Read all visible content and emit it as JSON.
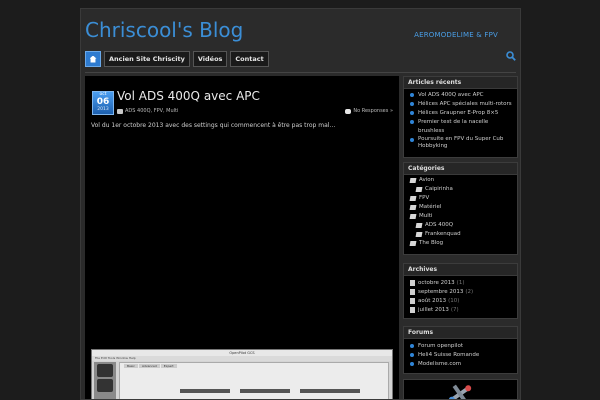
{
  "site": {
    "title": "Chriscool's Blog",
    "tagline": "AEROMODELIME & FPV"
  },
  "nav": {
    "items": [
      {
        "label": "Ancien Site Chriscity"
      },
      {
        "label": "Vidéos"
      },
      {
        "label": "Contact"
      }
    ]
  },
  "post": {
    "date": {
      "month": "oct",
      "day": "06",
      "year": "2013"
    },
    "title": "Vol ADS 400Q avec APC",
    "categories": "ADS 400Q, FPV, Multi",
    "comments": "No Responses »",
    "excerpt": "Vol du 1er octobre 2013 avec des settings qui commencent à être pas trop mal…",
    "screenshot": {
      "window_title": "OpenPilot GCS",
      "menu": "File   Edit   Tools   Window   Help",
      "tabs": [
        "Basic",
        "Advanced",
        "Expert"
      ]
    }
  },
  "widgets": {
    "recent": {
      "title": "Articles récents",
      "items": [
        "Vol ADS 400Q avec APC",
        "Hélices APC spéciales multi-rotors",
        "Hélices Graupner E-Prop 8×5",
        "Premier test de la nacelle brushless",
        "Poursuite en FPV du Super Cub Hobbyking"
      ]
    },
    "categories": {
      "title": "Catégories",
      "items": [
        {
          "label": "Avion",
          "level": 0
        },
        {
          "label": "Caipirinha",
          "level": 1
        },
        {
          "label": "FPV",
          "level": 0
        },
        {
          "label": "Matériel",
          "level": 0
        },
        {
          "label": "Multi",
          "level": 0
        },
        {
          "label": "ADS 400Q",
          "level": 1
        },
        {
          "label": "Frankenquad",
          "level": 1
        },
        {
          "label": "The Blog",
          "level": 0
        }
      ]
    },
    "archives": {
      "title": "Archives",
      "items": [
        {
          "label": "octobre 2013",
          "count": "(1)"
        },
        {
          "label": "septembre 2013",
          "count": "(2)"
        },
        {
          "label": "août 2013",
          "count": "(10)"
        },
        {
          "label": "juillet 2013",
          "count": "(7)"
        }
      ]
    },
    "forums": {
      "title": "Forums",
      "items": [
        "Forum openpilot",
        "Heli4 Suisse Romande",
        "Modelisme.com"
      ]
    }
  },
  "colors": {
    "accent": "#2e7bd0",
    "link": "#3b8ed6",
    "background": "#1c1c1c"
  }
}
